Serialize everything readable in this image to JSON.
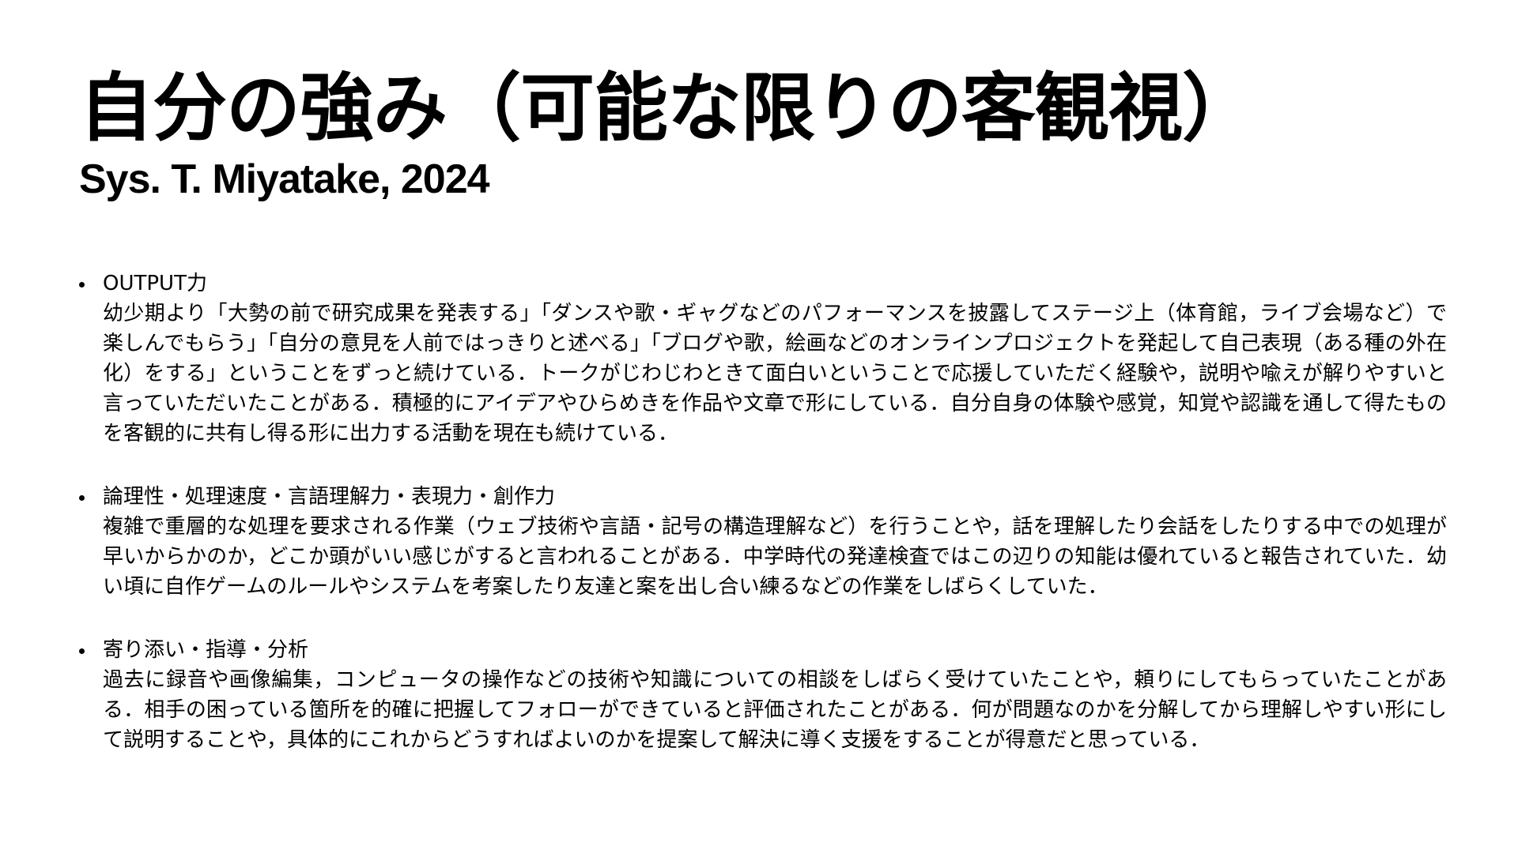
{
  "slide": {
    "title": "自分の強み（可能な限りの客観視）",
    "subtitle": "Sys. T. Miyatake, 2024",
    "items": [
      {
        "heading": "OUTPUT力",
        "body": "幼少期より「大勢の前で研究成果を発表する」「ダンスや歌・ギャグなどのパフォーマンスを披露してステージ上（体育館，ライブ会場など）で楽しんでもらう」「自分の意見を人前ではっきりと述べる」「ブログや歌，絵画などのオンラインプロジェクトを発起して自己表現（ある種の外在化）をする」ということをずっと続けている．トークがじわじわときて面白いということで応援していただく経験や，説明や喩えが解りやすいと言っていただいたことがある．積極的にアイデアやひらめきを作品や文章で形にしている．自分自身の体験や感覚，知覚や認識を通して得たものを客観的に共有し得る形に出力する活動を現在も続けている．"
      },
      {
        "heading": "論理性・処理速度・言語理解力・表現力・創作力",
        "body": "複雑で重層的な処理を要求される作業（ウェブ技術や言語・記号の構造理解など）を行うことや，話を理解したり会話をしたりする中での処理が早いからかのか，どこか頭がいい感じがすると言われることがある．中学時代の発達検査ではこの辺りの知能は優れていると報告されていた．幼い頃に自作ゲームのルールやシステムを考案したり友達と案を出し合い練るなどの作業をしばらくしていた．"
      },
      {
        "heading": "寄り添い・指導・分析",
        "body": "過去に録音や画像編集，コンピュータの操作などの技術や知識についての相談をしばらく受けていたことや，頼りにしてもらっていたことがある．相手の困っている箇所を的確に把握してフォローができていると評価されたことがある．何が問題なのかを分解してから理解しやすい形にして説明することや，具体的にこれからどうすればよいのかを提案して解決に導く支援をすることが得意だと思っている．"
      }
    ]
  }
}
